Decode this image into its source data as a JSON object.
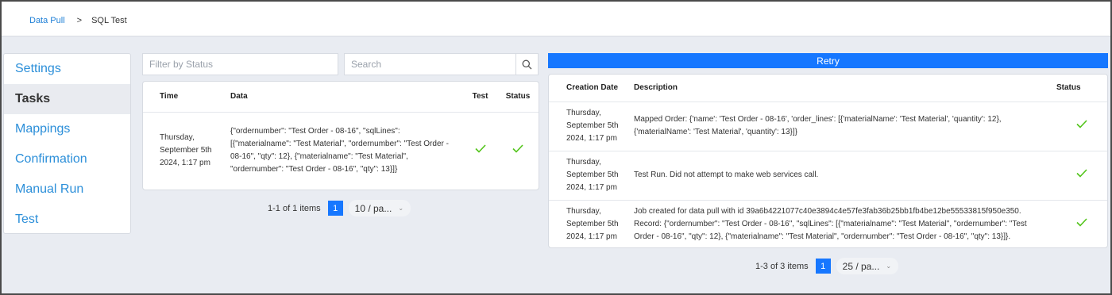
{
  "breadcrumb": {
    "parent": "Data Pull",
    "separator": ">",
    "current": "SQL Test"
  },
  "sidebar": {
    "items": [
      {
        "label": "Settings"
      },
      {
        "label": "Tasks",
        "active": true
      },
      {
        "label": "Mappings"
      },
      {
        "label": "Confirmation"
      },
      {
        "label": "Manual Run"
      },
      {
        "label": "Test"
      }
    ]
  },
  "filters": {
    "status_placeholder": "Filter by Status",
    "search_placeholder": "Search",
    "search_icon": "search-icon"
  },
  "tasks_table": {
    "headers": {
      "time": "Time",
      "data": "Data",
      "test": "Test",
      "status": "Status"
    },
    "rows": [
      {
        "time": "Thursday, September 5th 2024, 1:17 pm",
        "data": "{\"ordernumber\": \"Test Order - 08-16\", \"sqlLines\": [{\"materialname\": \"Test Material\", \"ordernumber\": \"Test Order - 08-16\", \"qty\": 12}, {\"materialname\": \"Test Material\", \"ordernumber\": \"Test Order - 08-16\", \"qty\": 13}]}",
        "test": "check-icon",
        "status": "check-icon"
      }
    ],
    "pagination": {
      "summary": "1-1 of 1 items",
      "page": "1",
      "page_size": "10 / pa..."
    }
  },
  "retry": {
    "label": "Retry"
  },
  "log_table": {
    "headers": {
      "creation_date": "Creation Date",
      "description": "Description",
      "status": "Status"
    },
    "rows": [
      {
        "date": "Thursday, September 5th 2024, 1:17 pm",
        "description": "Mapped Order: {'name': 'Test Order - 08-16', 'order_lines': [{'materialName': 'Test Material', 'quantity': 12}, {'materialName': 'Test Material', 'quantity': 13}]}",
        "status": "check-icon"
      },
      {
        "date": "Thursday, September 5th 2024, 1:17 pm",
        "description": "Test Run. Did not attempt to make web services call.",
        "status": "check-icon"
      },
      {
        "date": "Thursday, September 5th 2024, 1:17 pm",
        "description": "Job created for data pull with id 39a6b4221077c40e3894c4e57fe3fab36b25bb1fb4be12be55533815f950e350. Record: {\"ordernumber\": \"Test Order - 08-16\", \"sqlLines\": [{\"materialname\": \"Test Material\", \"ordernumber\": \"Test Order - 08-16\", \"qty\": 12}, {\"materialname\": \"Test Material\", \"ordernumber\": \"Test Order - 08-16\", \"qty\": 13}]}.",
        "status": "check-icon"
      }
    ],
    "pagination": {
      "summary": "1-3 of 3 items",
      "page": "1",
      "page_size": "25 / pa..."
    }
  },
  "colors": {
    "accent": "#1677ff",
    "link": "#2c8fd9",
    "success": "#52c41a"
  }
}
